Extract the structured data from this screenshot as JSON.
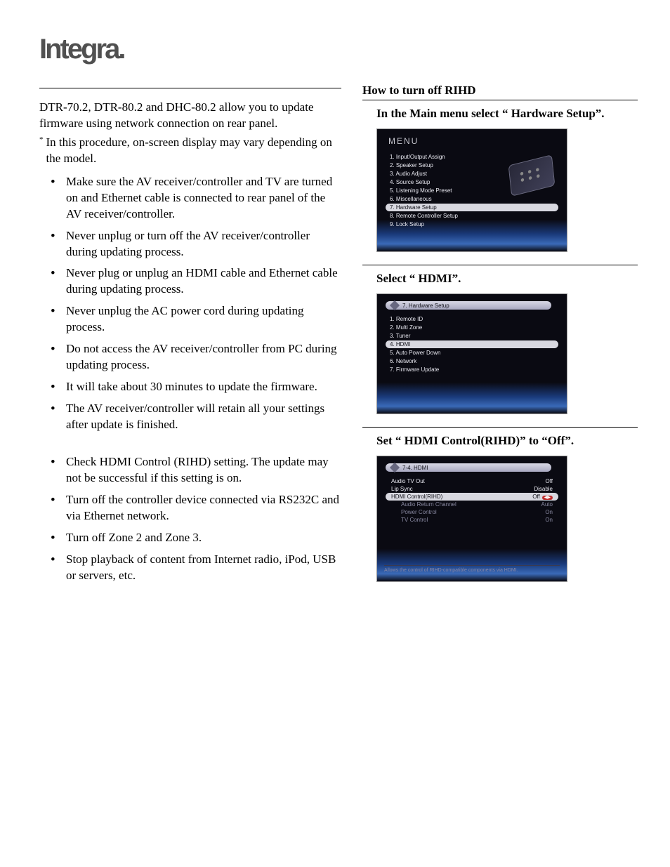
{
  "logo": "Integra.",
  "left": {
    "intro": "DTR-70.2, DTR-80.2 and DHC-80.2 allow you to update firmware using network connection on rear panel.",
    "note": "In this procedure, on-screen display may vary depending on the model.",
    "bullets_a": [
      "Make sure the AV receiver/controller and TV are turned on and Ethernet cable is connected to rear panel of the AV receiver/controller.",
      "Never unplug or turn off the AV receiver/controller during updating process.",
      "Never plug or unplug an HDMI cable and Ethernet cable during updating process.",
      "Never unplug the AC power cord during updating process.",
      "Do not access the AV receiver/controller from PC during updating process.",
      "It will take about 30 minutes to update the firmware.",
      "The AV receiver/controller will retain all your settings after update is finished."
    ],
    "bullets_b": [
      "Check HDMI Control (RIHD) setting. The update may not be successful if this setting is on.",
      "Turn off the controller device connected via RS232C and via Ethernet network.",
      "Turn off Zone 2 and Zone 3.",
      "Stop playback of content from Internet radio, iPod, USB or servers, etc."
    ]
  },
  "right": {
    "title": "How to turn off RIHD",
    "step1": "In the Main menu select “ Hardware Setup”.",
    "step2": "Select “ HDMI”.",
    "step3": "Set “ HDMI Control(RIHD)” to “Off”.",
    "screen1": {
      "heading": "MENU",
      "items": [
        "1. Input/Output Assign",
        "2. Speaker Setup",
        "3. Audio Adjust",
        "4. Source Setup",
        "5. Listening Mode Preset",
        "6. Miscellaneous",
        "7. Hardware Setup",
        "8. Remote Controller Setup",
        "9. Lock Setup"
      ],
      "selected_index": 6
    },
    "screen2": {
      "crumb": "7. Hardware Setup",
      "items": [
        "1. Remote ID",
        "2. Multi Zone",
        "3. Tuner",
        "4. HDMI",
        "5. Auto Power Down",
        "6. Network",
        "7. Firmware Update"
      ],
      "selected_index": 3
    },
    "screen3": {
      "crumb": "7-4. HDMI",
      "rows": [
        {
          "label": "Audio TV Out",
          "value": "Off",
          "indent": false,
          "sel": false
        },
        {
          "label": "Lip Sync",
          "value": "Disable",
          "indent": false,
          "sel": false
        },
        {
          "label": "HDMI Control(RIHD)",
          "value": "Off",
          "indent": false,
          "sel": true,
          "arrow": true
        },
        {
          "label": "Audio Return Channel",
          "value": "Auto",
          "indent": true,
          "sel": false
        },
        {
          "label": "Power Control",
          "value": "On",
          "indent": true,
          "sel": false
        },
        {
          "label": "TV Control",
          "value": "On",
          "indent": true,
          "sel": false
        }
      ],
      "footer": "Allows the control of RIHD-compatible components via HDMI."
    }
  }
}
